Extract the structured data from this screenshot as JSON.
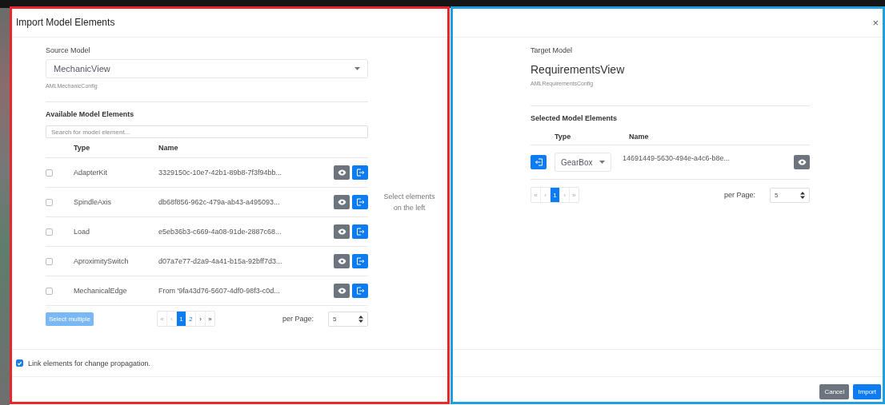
{
  "dialog": {
    "title": "Import Model Elements",
    "close": "×"
  },
  "source": {
    "label": "Source Model",
    "model": "MechanicView",
    "config": "AMLMechanicConfig",
    "section_title": "Available Model Elements",
    "search": {
      "placeholder": "Search for model element..."
    },
    "columns": [
      "Type",
      "Name"
    ],
    "rows": [
      {
        "type": "AdapterKit",
        "name": "3329150c-10e7-42b1-89b8-7f3f94bb...",
        "checked": false
      },
      {
        "type": "SpindleAxis",
        "name": "db68f856-962c-479a-ab43-a495093...",
        "checked": false
      },
      {
        "type": "Load",
        "name": "e5eb36b3-c669-4a08-91de-2887c68...",
        "checked": false
      },
      {
        "type": "AproximitySwitch",
        "name": "d07a7e77-d2a9-4a41-b15a-92bff7d3...",
        "checked": false
      },
      {
        "type": "MechanicalEdge",
        "name": "From '9fa43d76-5607-4df0-98f3-c0d...",
        "checked": false
      }
    ],
    "select_multiple": {
      "label": "Select multiple",
      "disabled": true
    },
    "pager": {
      "first": "«",
      "prev": "‹",
      "pages": [
        {
          "label": "1",
          "selected": true
        },
        {
          "label": "2",
          "selected": false
        }
      ],
      "next": "›",
      "last": "»"
    },
    "per_page": {
      "label": "per Page:",
      "value": "5"
    }
  },
  "middle": {
    "hint": "Select elements on the left"
  },
  "target": {
    "label": "Target Model",
    "model": "RequirementsView",
    "config": "AMLRequirementsConfig",
    "section_title": "Selected Model Elements",
    "columns": [
      "Type",
      "Name"
    ],
    "rows": [
      {
        "type": "GearBox",
        "name": "14691449-5630-494e-a4c6-b8e..."
      }
    ],
    "pager": {
      "first": "«",
      "prev": "‹",
      "pages": [
        {
          "label": "1",
          "selected": true
        }
      ],
      "next": "›",
      "last": "»"
    },
    "per_page": {
      "label": "per Page:",
      "value": "5"
    }
  },
  "link_option": {
    "label": "Link elements for change propagation.",
    "checked": true
  },
  "buttons": [
    {
      "label": "Cancel",
      "kind": "secondary"
    },
    {
      "label": "Import",
      "kind": "primary"
    }
  ],
  "annotations": [
    {
      "color": "#e8262b"
    },
    {
      "color": "#1e9fe0"
    }
  ]
}
